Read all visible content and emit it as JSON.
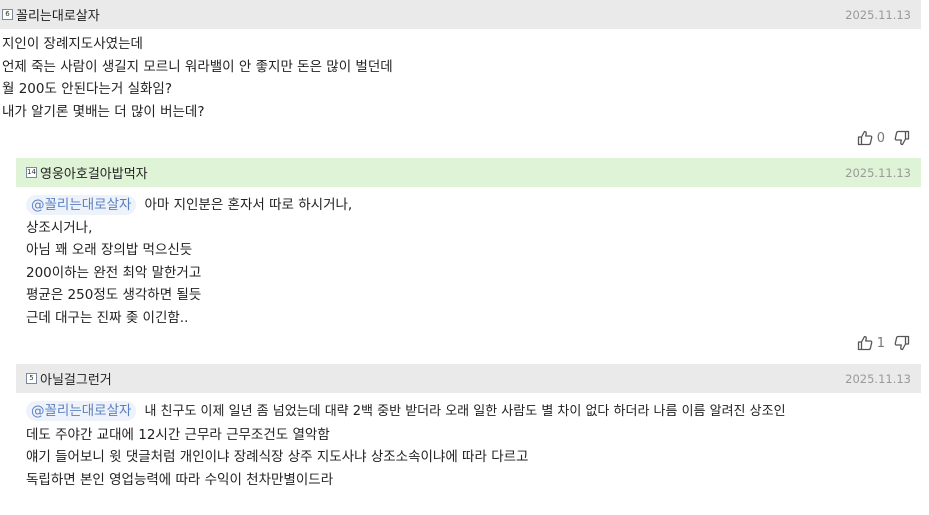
{
  "comments": [
    {
      "level": "6",
      "nickname": "꼴리는대로살자",
      "date": "2025.11.13",
      "lines": [
        "지인이 장례지도사였는데",
        "언제 죽는 사람이 생길지 모르니 워라밸이 안 좋지만 돈은 많이 벌던데",
        "월 200도 안된다는거 실화임?",
        "내가 알기론 몇배는 더 많이 버는데?"
      ],
      "likes": "0"
    },
    {
      "level": "14",
      "nickname": "영웅아호걸아밥먹자",
      "date": "2025.11.13",
      "mention": "@꼴리는대로살자",
      "lines": [
        "아마 지인분은 혼자서 따로 하시거나,",
        "상조시거나,",
        "아님 꽤 오래 장의밥 먹으신듯",
        "200이하는 완전 최악 말한거고",
        "평균은 250정도 생각하면 될듯",
        "근데 대구는 진짜 좆 이긴함.."
      ],
      "likes": "1"
    },
    {
      "level": "5",
      "nickname": "아닐걸그런거",
      "date": "2025.11.13",
      "mention": "@꼴리는대로살자",
      "lines": [
        "내 친구도 이제 일년 좀 넘었는데 대략 2백 중반 받더라 오래 일한 사람도 별 차이 없다 하더라 나름 이름 알려진 상조인",
        "데도 주야간 교대에 12시간 근무라 근무조건도 열악함",
        "얘기 들어보니 윗 댓글처럼 개인이냐 장례식장 상주 지도사냐 상조소속이냐에 따라 다르고",
        "독립하면 본인 영업능력에 따라 수익이 천차만별이드라"
      ]
    }
  ],
  "icons": {
    "like": "thumbs-up-icon",
    "dislike": "thumbs-down-icon",
    "level": "level-badge-icon"
  }
}
